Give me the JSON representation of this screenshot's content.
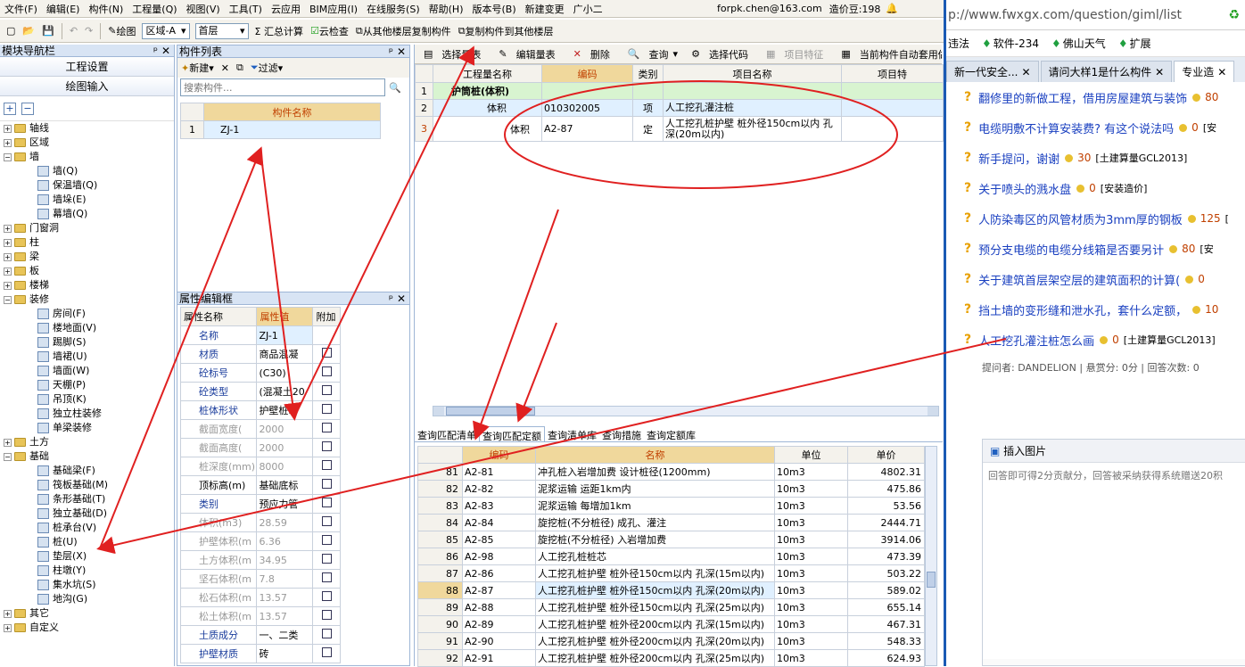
{
  "menu": [
    "文件(F)",
    "编辑(E)",
    "构件(N)",
    "工程量(Q)",
    "视图(V)",
    "工具(T)",
    "云应用",
    "BIM应用(I)",
    "在线服务(S)",
    "帮助(H)",
    "版本号(B)",
    "新建变更",
    "广小二"
  ],
  "account": {
    "email": "forpk.chen@163.com",
    "balance_label": "造价豆:198"
  },
  "toolbar": {
    "draw": "绘图",
    "area_label": "区域-A",
    "floor": "首层",
    "sum": "Σ 汇总计算",
    "cloud_check": "云检查",
    "copy_from": "从其他楼层复制构件",
    "copy_to": "复制构件到其他楼层"
  },
  "nav": {
    "title": "模块导航栏",
    "btn_project": "工程设置",
    "btn_draw": "绘图输入",
    "tree": [
      {
        "label": "轴线",
        "type": "folder",
        "open": false
      },
      {
        "label": "区域",
        "type": "folder",
        "open": false
      },
      {
        "label": "墙",
        "type": "folder",
        "open": true
      },
      {
        "label": "墙(Q)",
        "type": "leaf"
      },
      {
        "label": "保温墙(Q)",
        "type": "leaf"
      },
      {
        "label": "墙垛(E)",
        "type": "leaf"
      },
      {
        "label": "幕墙(Q)",
        "type": "leaf"
      },
      {
        "label": "门窗洞",
        "type": "folder",
        "open": false
      },
      {
        "label": "柱",
        "type": "folder",
        "open": false
      },
      {
        "label": "梁",
        "type": "folder",
        "open": false
      },
      {
        "label": "板",
        "type": "folder",
        "open": false
      },
      {
        "label": "楼梯",
        "type": "folder",
        "open": false
      },
      {
        "label": "装修",
        "type": "folder",
        "open": true
      },
      {
        "label": "房间(F)",
        "type": "leaf"
      },
      {
        "label": "楼地面(V)",
        "type": "leaf"
      },
      {
        "label": "踢脚(S)",
        "type": "leaf"
      },
      {
        "label": "墙裙(U)",
        "type": "leaf"
      },
      {
        "label": "墙面(W)",
        "type": "leaf"
      },
      {
        "label": "天棚(P)",
        "type": "leaf"
      },
      {
        "label": "吊顶(K)",
        "type": "leaf"
      },
      {
        "label": "独立柱装修",
        "type": "leaf"
      },
      {
        "label": "单梁装修",
        "type": "leaf"
      },
      {
        "label": "土方",
        "type": "folder",
        "open": false
      },
      {
        "label": "基础",
        "type": "folder",
        "open": true
      },
      {
        "label": "基础梁(F)",
        "type": "leaf"
      },
      {
        "label": "筏板基础(M)",
        "type": "leaf"
      },
      {
        "label": "条形基础(T)",
        "type": "leaf"
      },
      {
        "label": "独立基础(D)",
        "type": "leaf"
      },
      {
        "label": "桩承台(V)",
        "type": "leaf"
      },
      {
        "label": "桩(U)",
        "type": "leaf"
      },
      {
        "label": "垫层(X)",
        "type": "leaf"
      },
      {
        "label": "柱墩(Y)",
        "type": "leaf"
      },
      {
        "label": "集水坑(S)",
        "type": "leaf"
      },
      {
        "label": "地沟(G)",
        "type": "leaf"
      },
      {
        "label": "其它",
        "type": "folder",
        "open": false
      },
      {
        "label": "自定义",
        "type": "folder",
        "open": false
      }
    ]
  },
  "complist": {
    "title": "构件列表",
    "new": "新建",
    "filter": "过滤",
    "search_placeholder": "搜索构件...",
    "col": "构件名称",
    "rows": [
      {
        "no": "1",
        "name": "ZJ-1"
      }
    ]
  },
  "props": {
    "title": "属性编辑框",
    "cols": [
      "属性名称",
      "属性值",
      "附加"
    ],
    "rows": [
      {
        "name": "名称",
        "value": "ZJ-1",
        "blue": true,
        "check": false
      },
      {
        "name": "材质",
        "value": "商品混凝",
        "blue": true,
        "check": true
      },
      {
        "name": "砼标号",
        "value": "(C30)",
        "blue": true,
        "check": true
      },
      {
        "name": "砼类型",
        "value": "(混凝土20",
        "blue": true,
        "check": true
      },
      {
        "name": "桩体形状",
        "value": "护壁桩3",
        "blue": true,
        "check": true
      },
      {
        "name": "截面宽度(",
        "value": "2000",
        "blue": false,
        "check": true
      },
      {
        "name": "截面高度(",
        "value": "2000",
        "blue": false,
        "check": true
      },
      {
        "name": "桩深度(mm)",
        "value": "8000",
        "blue": false,
        "check": true
      },
      {
        "name": "顶标高(m)",
        "value": "基础底标",
        "blue": false,
        "check": true,
        "dark": true
      },
      {
        "name": "类别",
        "value": "预应力管",
        "blue": true,
        "check": true
      },
      {
        "name": "体积(m3)",
        "value": "28.59",
        "blue": false,
        "check": true
      },
      {
        "name": "护壁体积(m",
        "value": "6.36",
        "blue": false,
        "check": true
      },
      {
        "name": "土方体积(m",
        "value": "34.95",
        "blue": false,
        "check": true
      },
      {
        "name": "坚石体积(m",
        "value": "7.8",
        "blue": false,
        "check": true
      },
      {
        "name": "松石体积(m",
        "value": "13.57",
        "blue": false,
        "check": true
      },
      {
        "name": "松土体积(m",
        "value": "13.57",
        "blue": false,
        "check": true
      },
      {
        "name": "土质成分",
        "value": "一、二类",
        "blue": true,
        "check": true
      },
      {
        "name": "护壁材质",
        "value": "砖",
        "blue": true,
        "check": true
      }
    ]
  },
  "rtool": {
    "select": "选择量表",
    "edit": "编辑量表",
    "delete": "删除",
    "query": "查询",
    "code": "选择代码",
    "feature": "项目特征",
    "auto": "当前构件自动套用做法"
  },
  "qty": {
    "cols": [
      "工程量名称",
      "编码",
      "类别",
      "项目名称",
      "项目特"
    ],
    "rows": [
      {
        "no": "1",
        "name": "护筒桩(体积)",
        "code": "",
        "type": "",
        "item": "",
        "group": true
      },
      {
        "no": "2",
        "name": "体积",
        "code": "010302005",
        "type": "项",
        "item": "人工挖孔灌注桩"
      },
      {
        "no": "3",
        "name": "体积",
        "code": "A2-87",
        "type": "定",
        "item": "人工挖孔桩护壁 桩外径150cm以内 孔深(20m以内)"
      }
    ]
  },
  "qtabs": [
    "查询匹配清单",
    "查询匹配定额",
    "查询清单库",
    "查询措施",
    "查询定额库"
  ],
  "quota": {
    "cols": [
      "编码",
      "名称",
      "单位",
      "单价"
    ],
    "rows": [
      {
        "no": "81",
        "code": "A2-81",
        "name": "冲孔桩入岩增加费 设计桩径(1200mm)",
        "unit": "10m3",
        "price": "4802.31"
      },
      {
        "no": "82",
        "code": "A2-82",
        "name": "泥浆运输 运距1km内",
        "unit": "10m3",
        "price": "475.86"
      },
      {
        "no": "83",
        "code": "A2-83",
        "name": "泥浆运输 每增加1km",
        "unit": "10m3",
        "price": "53.56"
      },
      {
        "no": "84",
        "code": "A2-84",
        "name": "旋挖桩(不分桩径) 成孔、灌注",
        "unit": "10m3",
        "price": "2444.71"
      },
      {
        "no": "85",
        "code": "A2-85",
        "name": "旋挖桩(不分桩径) 入岩增加费",
        "unit": "10m3",
        "price": "3914.06"
      },
      {
        "no": "86",
        "code": "A2-98",
        "name": "人工挖孔桩桩芯",
        "unit": "10m3",
        "price": "473.39"
      },
      {
        "no": "87",
        "code": "A2-86",
        "name": "人工挖孔桩护壁 桩外径150cm以内 孔深(15m以内)",
        "unit": "10m3",
        "price": "503.22"
      },
      {
        "no": "88",
        "code": "A2-87",
        "name": "人工挖孔桩护壁 桩外径150cm以内 孔深(20m以内)",
        "unit": "10m3",
        "price": "589.02"
      },
      {
        "no": "89",
        "code": "A2-88",
        "name": "人工挖孔桩护壁 桩外径150cm以内 孔深(25m以内)",
        "unit": "10m3",
        "price": "655.14"
      },
      {
        "no": "90",
        "code": "A2-89",
        "name": "人工挖孔桩护壁 桩外径200cm以内 孔深(15m以内)",
        "unit": "10m3",
        "price": "467.31"
      },
      {
        "no": "91",
        "code": "A2-90",
        "name": "人工挖孔桩护壁 桩外径200cm以内 孔深(20m以内)",
        "unit": "10m3",
        "price": "548.33"
      },
      {
        "no": "92",
        "code": "A2-91",
        "name": "人工挖孔桩护壁 桩外径200cm以内 孔深(25m以内)",
        "unit": "10m3",
        "price": "624.93"
      }
    ]
  },
  "browser": {
    "url": "p://www.fwxgx.com/question/giml/list",
    "bookmarks": [
      "违法",
      "软件-234",
      "佛山天气",
      "扩展"
    ],
    "tabs": [
      "新一代安全...",
      "请问大样1是什么构件",
      "专业造"
    ],
    "questions": [
      {
        "title": "翻修里的新做工程，借用房屋建筑与装饰",
        "pts": "80",
        "tag": ""
      },
      {
        "title": "电缆明敷不计算安装费? 有这个说法吗",
        "pts": "0",
        "tag": "[安"
      },
      {
        "title": "新手提问，谢谢",
        "pts": "30",
        "tag": "[土建算量GCL2013]"
      },
      {
        "title": "关于喷头的溅水盘",
        "pts": "0",
        "tag": "[安装造价]"
      },
      {
        "title": "人防染毒区的风管材质为3mm厚的钢板",
        "pts": "125",
        "tag": "["
      },
      {
        "title": "预分支电缆的电缆分线箱是否要另计",
        "pts": "80",
        "tag": "[安"
      },
      {
        "title": "关于建筑首层架空层的建筑面积的计算(",
        "pts": "0",
        "tag": ""
      },
      {
        "title": "挡土墙的变形缝和泄水孔，套什么定额，",
        "pts": "10",
        "tag": ""
      },
      {
        "title": "人工挖孔灌注桩怎么画",
        "pts": "0",
        "tag": "[土建算量GCL2013]"
      }
    ],
    "asker": "提问者: DANDELION  |  悬赏分: 0分  |  回答次数: 0",
    "insert_img": "插入图片",
    "answer_placeholder": "回答即可得2分贡献分，回答被采纳获得系统赠送20积"
  }
}
